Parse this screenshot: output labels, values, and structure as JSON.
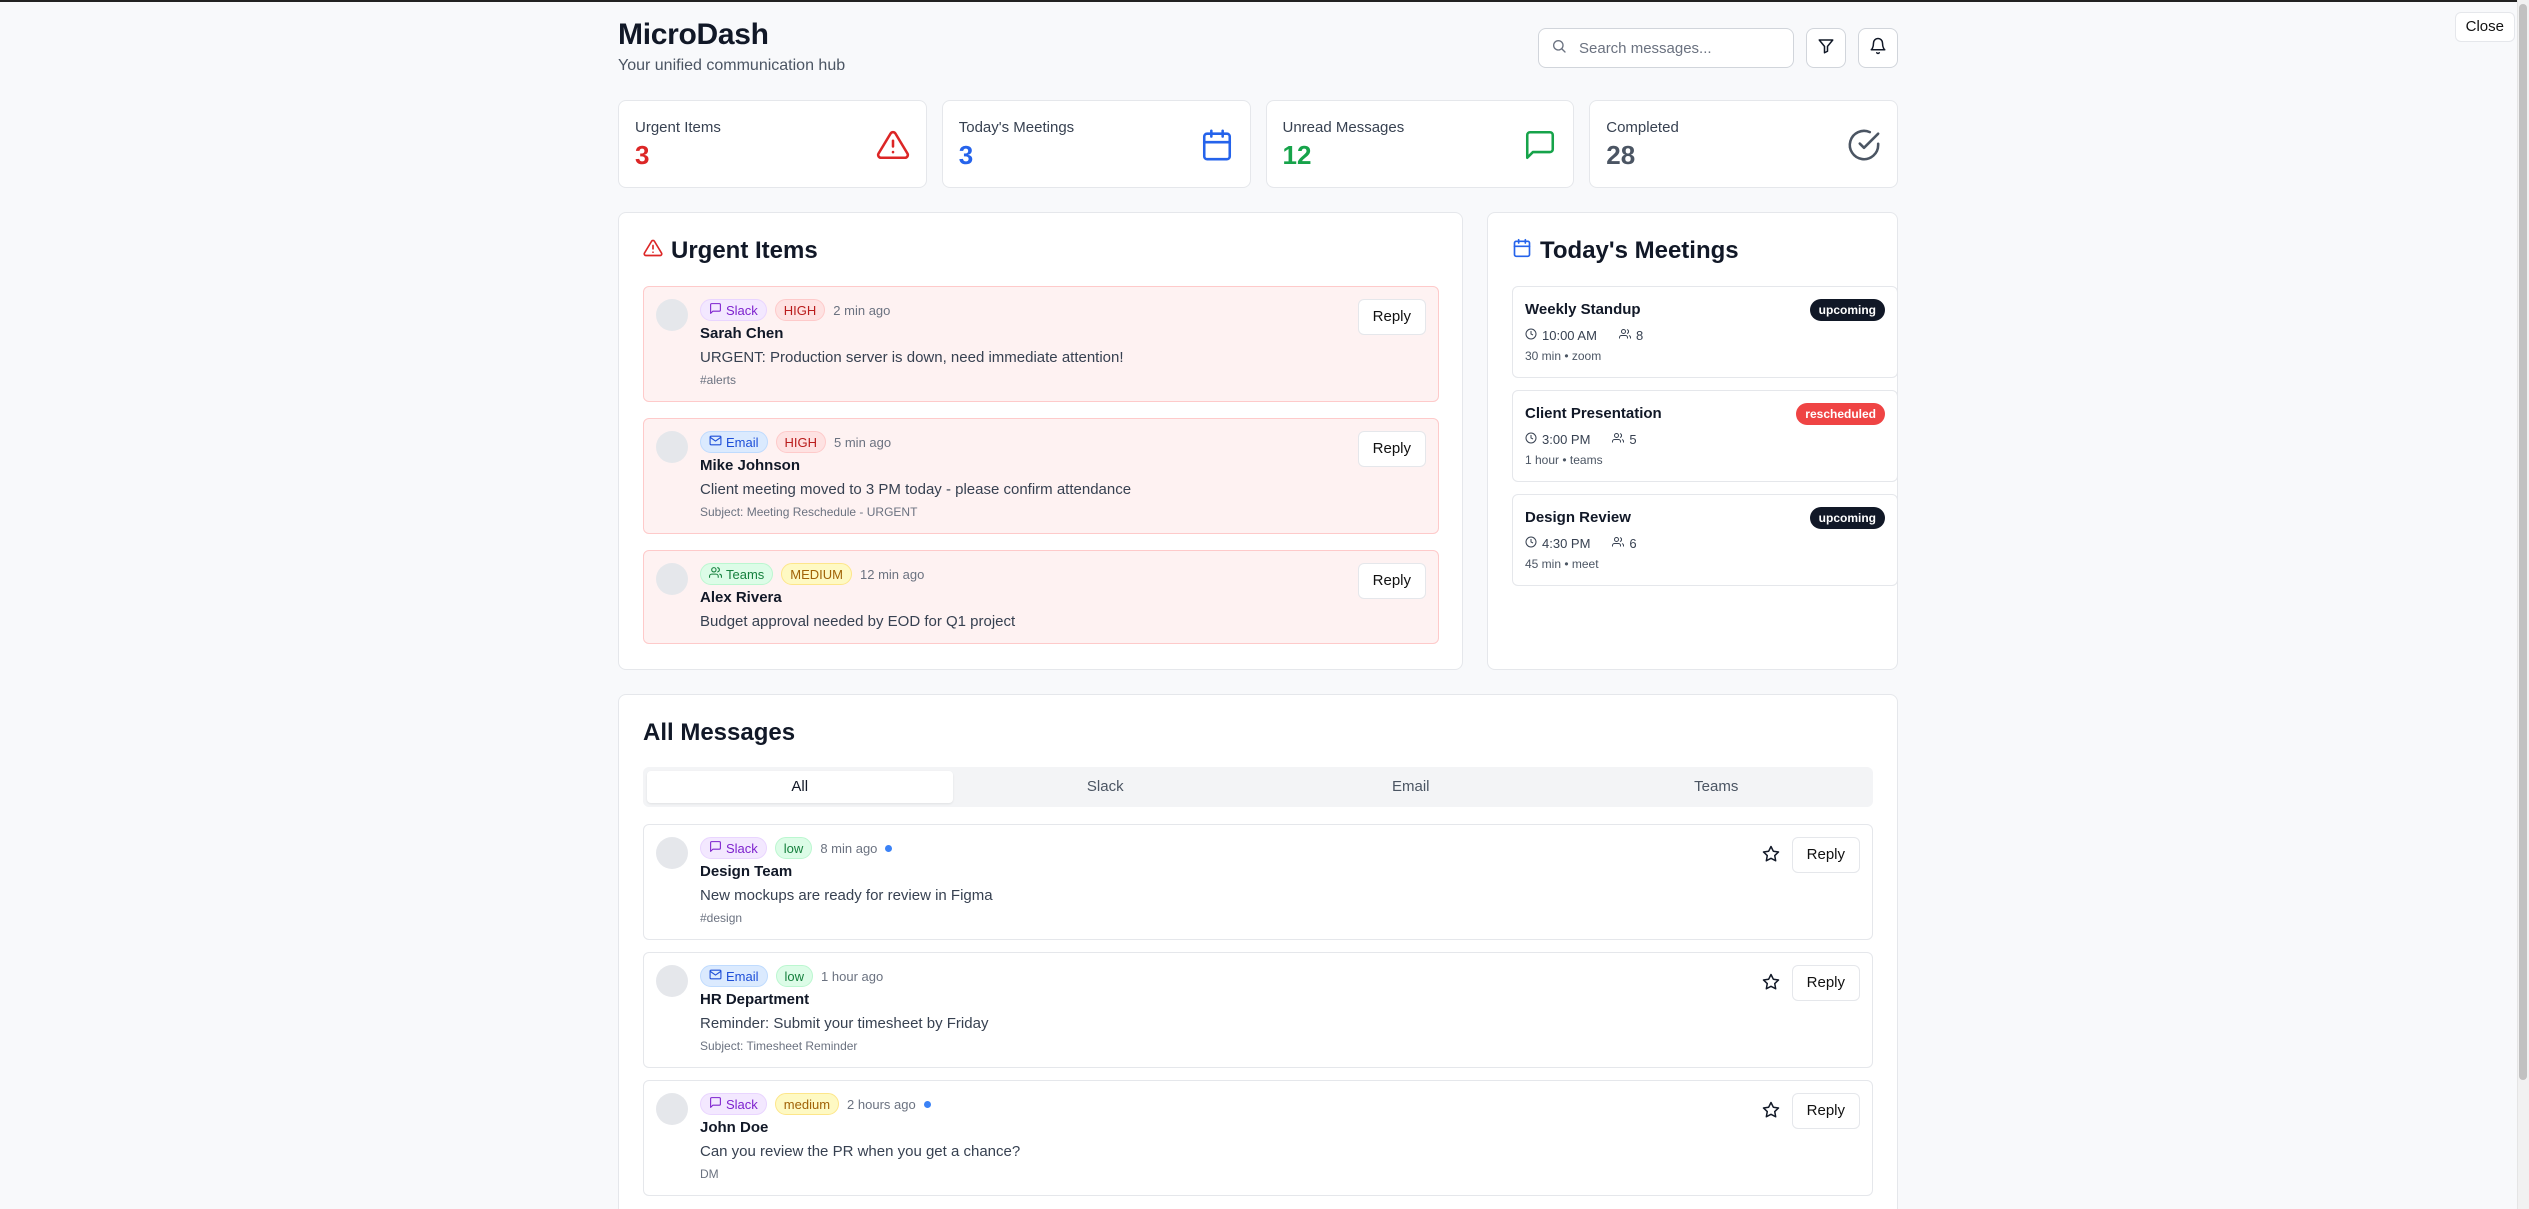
{
  "window": {
    "close_label": "Close"
  },
  "header": {
    "title": "MicroDash",
    "subtitle": "Your unified communication hub",
    "search_placeholder": "Search messages...",
    "filter_icon": "filter-icon",
    "bell_icon": "bell-icon"
  },
  "stats": [
    {
      "label": "Urgent Items",
      "value": "3",
      "color": "#dc2626",
      "icon": "alert-triangle-icon"
    },
    {
      "label": "Today's Meetings",
      "value": "3",
      "color": "#2563eb",
      "icon": "calendar-icon"
    },
    {
      "label": "Unread Messages",
      "value": "12",
      "color": "#16a34a",
      "icon": "message-square-icon"
    },
    {
      "label": "Completed",
      "value": "28",
      "color": "#4b5563",
      "icon": "check-circle-icon"
    }
  ],
  "urgent": {
    "title": "Urgent Items",
    "items": [
      {
        "source": "Slack",
        "priority": "HIGH",
        "time": "2 min ago",
        "sender": "Sarah Chen",
        "content": "URGENT: Production server is down, need immediate attention!",
        "meta": "#alerts",
        "reply": "Reply"
      },
      {
        "source": "Email",
        "priority": "HIGH",
        "time": "5 min ago",
        "sender": "Mike Johnson",
        "content": "Client meeting moved to 3 PM today - please confirm attendance",
        "meta": "Subject: Meeting Reschedule - URGENT",
        "reply": "Reply"
      },
      {
        "source": "Teams",
        "priority": "MEDIUM",
        "time": "12 min ago",
        "sender": "Alex Rivera",
        "content": "Budget approval needed by EOD for Q1 project",
        "meta": "",
        "reply": "Reply"
      }
    ]
  },
  "meetings": {
    "title": "Today's Meetings",
    "items": [
      {
        "title": "Weekly Standup",
        "status": "upcoming",
        "time": "10:00 AM",
        "attendees": "8",
        "extra": "30 min • zoom"
      },
      {
        "title": "Client Presentation",
        "status": "rescheduled",
        "time": "3:00 PM",
        "attendees": "5",
        "extra": "1 hour • teams"
      },
      {
        "title": "Design Review",
        "status": "upcoming",
        "time": "4:30 PM",
        "attendees": "6",
        "extra": "45 min • meet"
      }
    ]
  },
  "messages": {
    "title": "All Messages",
    "tabs": [
      "All",
      "Slack",
      "Email",
      "Teams"
    ],
    "active_tab": "All",
    "items": [
      {
        "source": "Slack",
        "priority": "low",
        "time": "8 min ago",
        "unread": true,
        "sender": "Design Team",
        "content": "New mockups are ready for review in Figma",
        "meta": "#design",
        "reply": "Reply"
      },
      {
        "source": "Email",
        "priority": "low",
        "time": "1 hour ago",
        "unread": false,
        "sender": "HR Department",
        "content": "Reminder: Submit your timesheet by Friday",
        "meta": "Subject: Timesheet Reminder",
        "reply": "Reply"
      },
      {
        "source": "Slack",
        "priority": "medium",
        "time": "2 hours ago",
        "unread": true,
        "sender": "John Doe",
        "content": "Can you review the PR when you get a chance?",
        "meta": "DM",
        "reply": "Reply"
      }
    ]
  }
}
